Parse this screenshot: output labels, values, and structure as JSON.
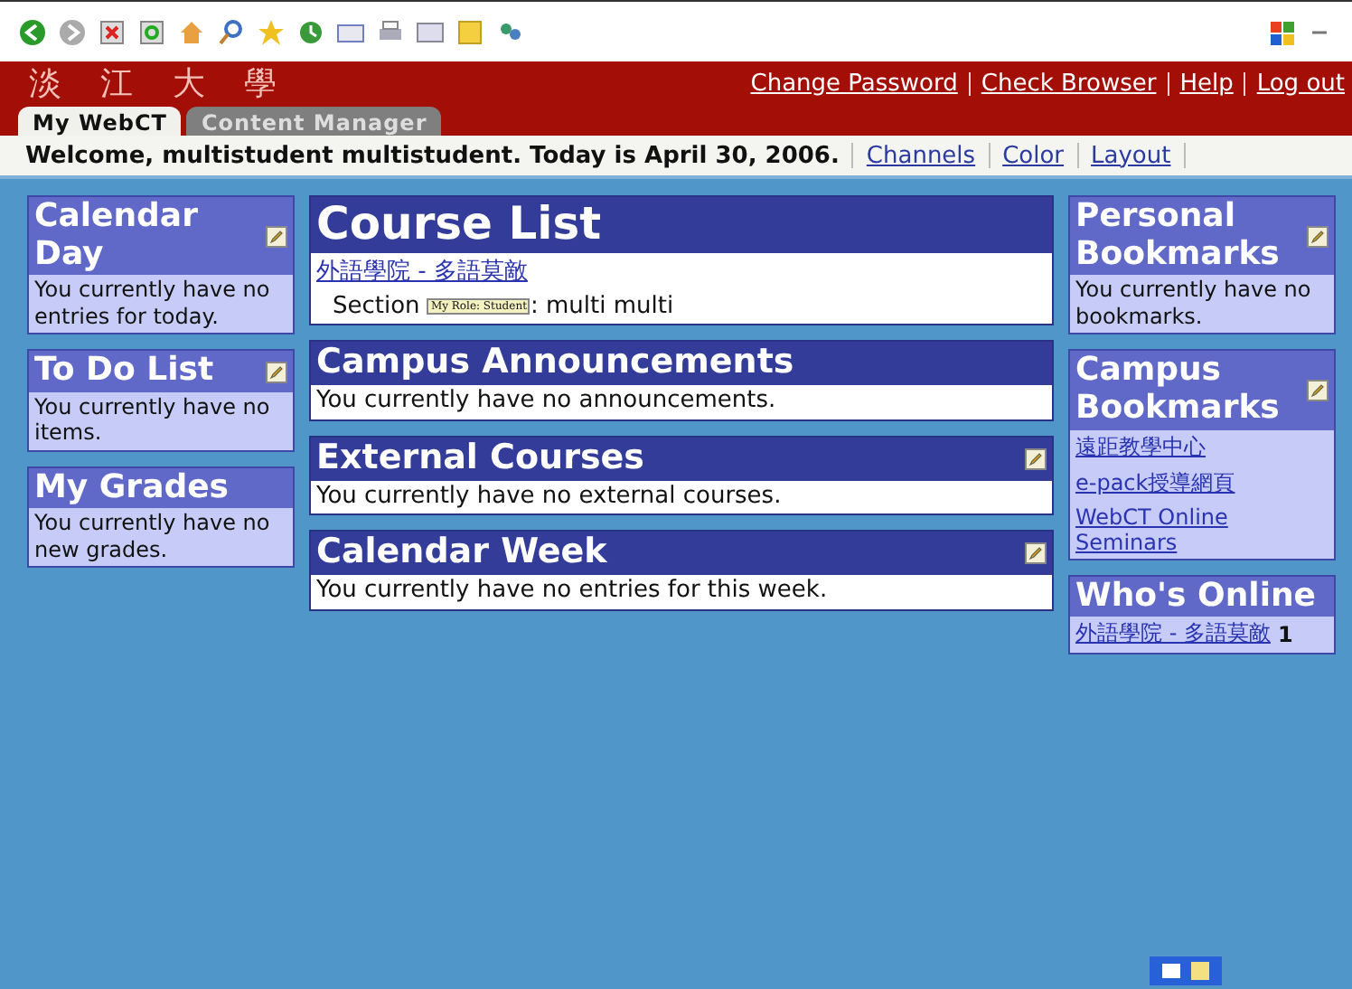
{
  "header": {
    "logo": "淡 江 大 學",
    "links": [
      "Change Password",
      "Check Browser",
      "Help",
      "Log out"
    ]
  },
  "tabs": [
    {
      "label": "My WebCT",
      "selected": true
    },
    {
      "label": "Content Manager",
      "selected": false
    }
  ],
  "welcome": {
    "text": "Welcome, multistudent multistudent. Today is April 30, 2006.",
    "links": [
      "Channels",
      "Color",
      "Layout"
    ]
  },
  "left_column": [
    {
      "title": "Calendar Day",
      "editable": true,
      "items": [
        {
          "kind": "text",
          "text": "You currently have no entries for today."
        }
      ]
    },
    {
      "title": "To Do List",
      "editable": true,
      "items": [
        {
          "kind": "text",
          "text": "You currently have no items."
        }
      ]
    },
    {
      "title": "My Grades",
      "editable": false,
      "items": [
        {
          "kind": "text",
          "text": "You currently have no new grades."
        }
      ]
    }
  ],
  "center_column": [
    {
      "title": "Course List",
      "kind": "large",
      "editable": false,
      "items": [
        {
          "kind": "link",
          "text": "外語學院 - 多語莫敵"
        },
        {
          "kind": "section",
          "label": "Section",
          "badge": "My Role: Student",
          "text": ": multi multi"
        }
      ]
    },
    {
      "title": "Campus Announcements",
      "kind": "normal",
      "editable": false,
      "items": [
        {
          "kind": "text",
          "text": "You currently have no announcements."
        }
      ]
    },
    {
      "title": "External Courses",
      "kind": "normal",
      "editable": true,
      "items": [
        {
          "kind": "text",
          "text": "You currently have no external courses."
        }
      ]
    },
    {
      "title": "Calendar Week",
      "kind": "normal",
      "editable": true,
      "items": [
        {
          "kind": "text",
          "text": "You currently have no entries for this week."
        }
      ]
    }
  ],
  "right_column": [
    {
      "title": "Personal Bookmarks",
      "editable": true,
      "items": [
        {
          "kind": "text",
          "text": "You currently have no bookmarks."
        }
      ]
    },
    {
      "title": "Campus Bookmarks",
      "editable": true,
      "items": [
        {
          "kind": "link",
          "text": "遠距教學中心"
        },
        {
          "kind": "link",
          "text": "e-pack授導網頁"
        },
        {
          "kind": "link",
          "text": "WebCT Online Seminars"
        }
      ]
    },
    {
      "title": "Who's Online",
      "editable": false,
      "items": [
        {
          "kind": "count",
          "text": "外語學院 - 多語莫敵",
          "count": "1"
        }
      ]
    }
  ]
}
